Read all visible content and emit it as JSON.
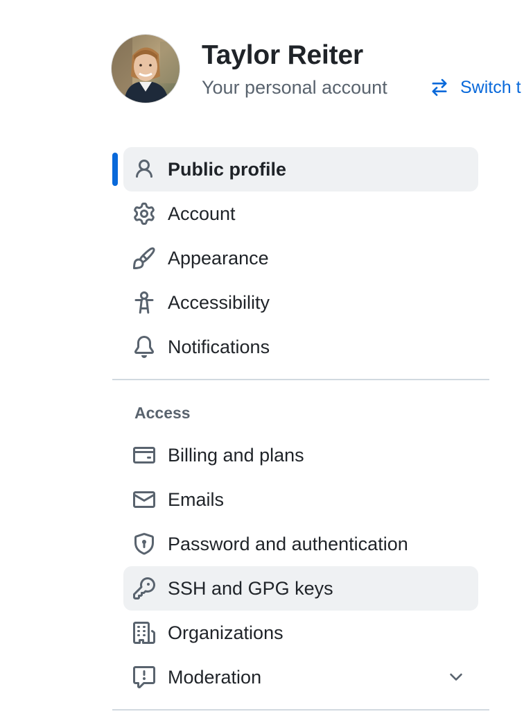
{
  "header": {
    "user_name": "Taylor Reiter",
    "subtitle": "Your personal account",
    "switch_label": "Switch t",
    "switch_icon": "arrow-switch-icon",
    "accent_color": "#0969da"
  },
  "nav": {
    "primary": [
      {
        "label": "Public profile",
        "icon": "person-icon",
        "selected": true
      },
      {
        "label": "Account",
        "icon": "gear-icon"
      },
      {
        "label": "Appearance",
        "icon": "paintbrush-icon"
      },
      {
        "label": "Accessibility",
        "icon": "accessibility-icon"
      },
      {
        "label": "Notifications",
        "icon": "bell-icon"
      }
    ],
    "access_heading": "Access",
    "access": [
      {
        "label": "Billing and plans",
        "icon": "credit-card-icon"
      },
      {
        "label": "Emails",
        "icon": "mail-icon"
      },
      {
        "label": "Password and authentication",
        "icon": "shield-lock-icon"
      },
      {
        "label": "SSH and GPG keys",
        "icon": "key-icon",
        "hovered": true
      },
      {
        "label": "Organizations",
        "icon": "organization-icon"
      },
      {
        "label": "Moderation",
        "icon": "report-icon",
        "expandable": true
      }
    ]
  }
}
